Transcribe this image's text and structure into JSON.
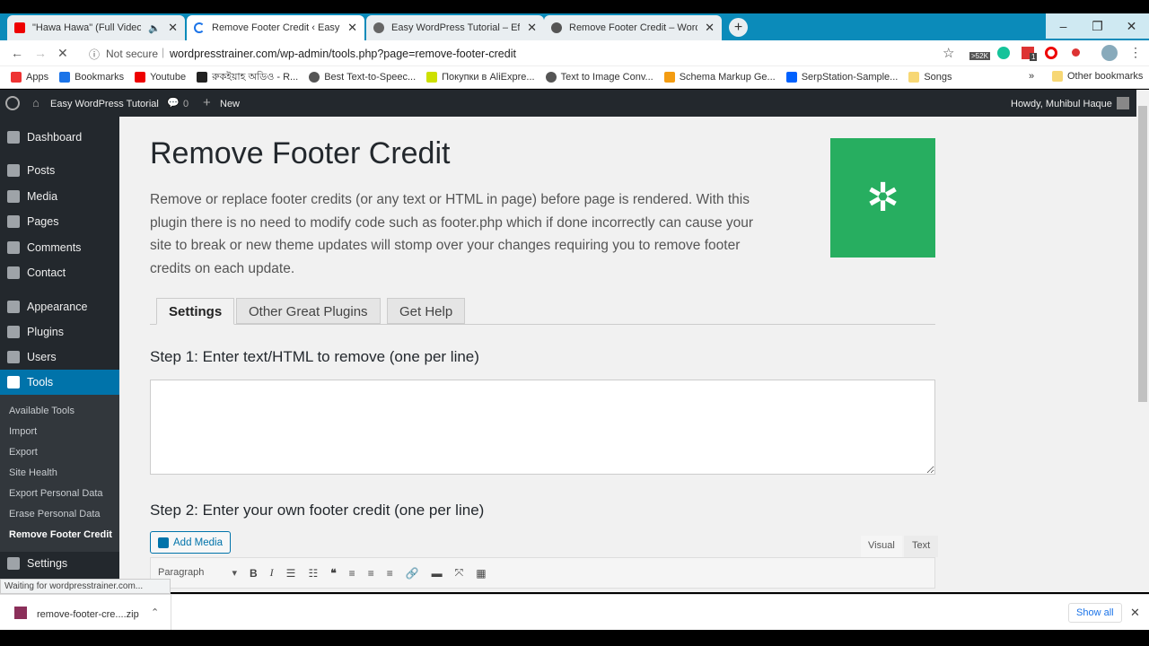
{
  "browser": {
    "tabs": [
      {
        "title": "\"Hawa Hawa\" (Full Video So",
        "icon": "youtube-icon",
        "audio": true
      },
      {
        "title": "Remove Footer Credit ‹ Easy Wor",
        "icon": "loading-icon",
        "active": true
      },
      {
        "title": "Easy WordPress Tutorial – Effortl",
        "icon": "globe-icon"
      },
      {
        "title": "Remove Footer Credit – WordPre",
        "icon": "wordpress-icon"
      }
    ],
    "security": "Not secure",
    "url": "wordpresstrainer.com/wp-admin/tools.php?page=remove-footer-credit",
    "ext_badge": ">52K",
    "ext_count": "1",
    "bookmarks": [
      {
        "label": "Apps",
        "color": "#e33"
      },
      {
        "label": "Bookmarks",
        "color": "#1a73e8"
      },
      {
        "label": "Youtube",
        "color": "#e00"
      },
      {
        "label": "রুকইয়াহ অডিও - R...",
        "color": "#222"
      },
      {
        "label": "Best Text-to-Speec...",
        "color": "#555"
      },
      {
        "label": "Покупки в AliExpre...",
        "color": "#cde000"
      },
      {
        "label": "Text to Image Conv...",
        "color": "#555"
      },
      {
        "label": "Schema Markup Ge...",
        "color": "#f39c12"
      },
      {
        "label": "SerpStation-Sample...",
        "color": "#0061fe"
      },
      {
        "label": "Songs",
        "color": "#f7d774"
      }
    ],
    "more": "»",
    "other_bookmarks": "Other bookmarks",
    "status": "Waiting for wordpresstrainer.com...",
    "download": "remove-footer-cre....zip",
    "show_all": "Show all"
  },
  "adminbar": {
    "site": "Easy WordPress Tutorial",
    "comments": "0",
    "new": "New",
    "howdy": "Howdy, Muhibul Haque"
  },
  "sidebar": {
    "items": [
      "Dashboard",
      "Posts",
      "Media",
      "Pages",
      "Comments",
      "Contact",
      "Appearance",
      "Plugins",
      "Users",
      "Tools",
      "Settings"
    ],
    "sub": [
      "Available Tools",
      "Import",
      "Export",
      "Site Health",
      "Export Personal Data",
      "Erase Personal Data",
      "Remove Footer Credit"
    ]
  },
  "page": {
    "title": "Remove Footer Credit",
    "description": "Remove or replace footer credits (or any text or HTML in page) before page is rendered. With this plugin there is no need to modify code such as footer.php which if done incorrectly can cause your site to break or new theme updates will stomp over your changes requiring you to remove footer credits on each update.",
    "logo_color": "#27ae60",
    "tabs": [
      "Settings",
      "Other Great Plugins",
      "Get Help"
    ],
    "step1": "Step 1: Enter text/HTML to remove (one per line)",
    "step1_value": "",
    "step2": "Step 2: Enter your own footer credit (one per line)",
    "add_media": "Add Media",
    "visual": "Visual",
    "text": "Text",
    "format": "Paragraph"
  }
}
